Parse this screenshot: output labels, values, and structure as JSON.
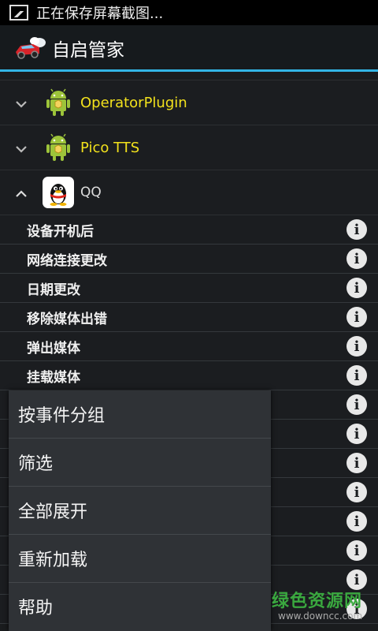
{
  "status_bar": {
    "notification_text": "正在保存屏幕截图..."
  },
  "action_bar": {
    "title": "自启管家"
  },
  "groups": [
    {
      "label": "OperatorPlugin",
      "expanded": false,
      "icon": "android-icon"
    },
    {
      "label": "Pico TTS",
      "expanded": false,
      "icon": "android-icon"
    },
    {
      "label": "QQ",
      "expanded": true,
      "icon": "qq-penguin-icon"
    }
  ],
  "qq_events": [
    {
      "label": "设备开机后"
    },
    {
      "label": "网络连接更改"
    },
    {
      "label": "日期更改"
    },
    {
      "label": "移除媒体出错"
    },
    {
      "label": "弹出媒体"
    },
    {
      "label": "挂载媒体"
    }
  ],
  "popup_menu": {
    "items": [
      "按事件分组",
      "筛选",
      "全部展开",
      "重新加载",
      "帮助"
    ]
  },
  "watermark": {
    "main": "绿色资源网",
    "sub": "www.downcc.com"
  },
  "colors": {
    "accent": "#33b5e5",
    "package_label": "#f2e11c",
    "watermark": "#3aa83f"
  }
}
